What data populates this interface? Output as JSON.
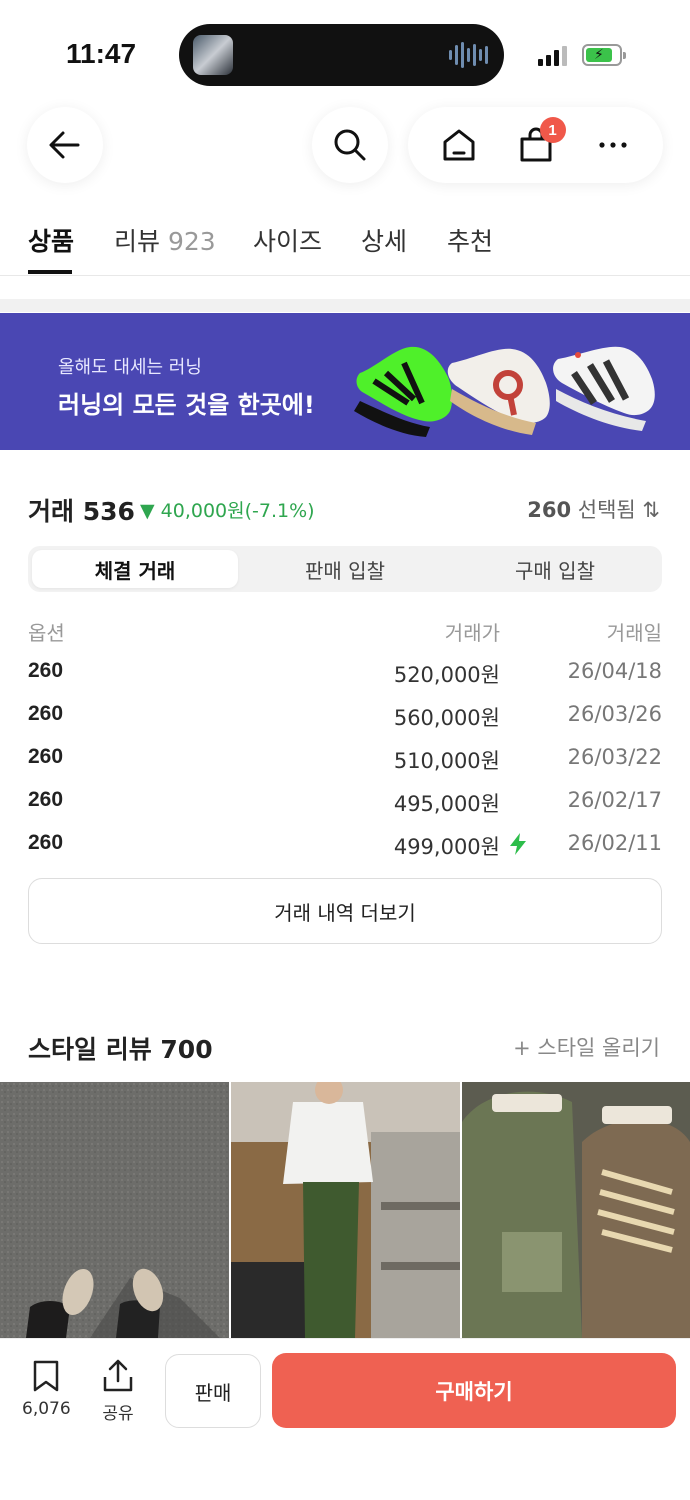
{
  "status_bar": {
    "time": "11:47"
  },
  "header": {
    "cart_count": "1"
  },
  "tabs": [
    {
      "label": "상품",
      "count": ""
    },
    {
      "label": "리뷰",
      "count": "923"
    },
    {
      "label": "사이즈",
      "count": ""
    },
    {
      "label": "상세",
      "count": ""
    },
    {
      "label": "추천",
      "count": ""
    }
  ],
  "banner": {
    "subtitle": "올해도 대세는 러닝",
    "title": "러닝의 모든 것을 한곳에!",
    "background": "#4a47b3"
  },
  "trades": {
    "title": "거래 536",
    "change": "▼ 40,000원(-7.1%)",
    "size_select": "260",
    "size_select_suffix": "선택됨 ⇅",
    "segments": [
      "체결 거래",
      "판매 입찰",
      "구매 입찰"
    ],
    "columns": {
      "option": "옵션",
      "price": "거래가",
      "date": "거래일"
    },
    "rows": [
      {
        "option": "260",
        "price": "520,000원",
        "date": "26/04/18",
        "fast": false
      },
      {
        "option": "260",
        "price": "560,000원",
        "date": "26/03/26",
        "fast": false
      },
      {
        "option": "260",
        "price": "510,000원",
        "date": "26/03/22",
        "fast": false
      },
      {
        "option": "260",
        "price": "495,000원",
        "date": "26/02/17",
        "fast": false
      },
      {
        "option": "260",
        "price": "499,000원",
        "date": "26/02/11",
        "fast": true
      }
    ],
    "more_label": "거래 내역 더보기",
    "down_color": "#2fa64f"
  },
  "style_review": {
    "title": "스타일 리뷰 700",
    "upload_label": "+ 스타일 올리기"
  },
  "bottom_bar": {
    "bookmark_count": "6,076",
    "share_label": "공유",
    "sell_label": "판매",
    "buy_label": "구매하기",
    "buy_color": "#ef6152"
  }
}
